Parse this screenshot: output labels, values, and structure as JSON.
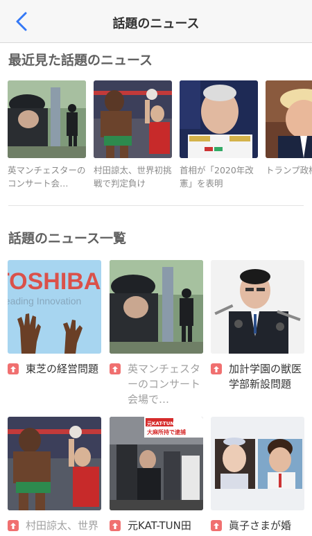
{
  "nav": {
    "title": "話題のニュース",
    "back_icon": "chevron-left-icon",
    "accent": "#3478f6"
  },
  "recent": {
    "heading": "最近見た話題のニュース",
    "items": [
      {
        "caption": "英マンチェスターのコンサート会…"
      },
      {
        "caption": "村田諒太、世界初挑戦で判定負け"
      },
      {
        "caption": "首相が「2020年改憲」を表明"
      },
      {
        "caption": "トランプ政権"
      }
    ]
  },
  "list": {
    "heading": "話題のニュース一覧",
    "badge_color": "#f07070",
    "items": [
      {
        "caption": "東芝の経営問題",
        "visited": false
      },
      {
        "caption": "英マンチェスターのコンサート会場で…",
        "visited": true
      },
      {
        "caption": "加計学園の獣医学部新設問題",
        "visited": false
      },
      {
        "caption": "村田諒太、世界",
        "visited": true
      },
      {
        "caption": "元KAT-TUN田",
        "visited": false
      },
      {
        "caption": "眞子さまが婚",
        "visited": false
      }
    ],
    "thumb_text": {
      "toshiba_logo": "TOSHIBA",
      "toshiba_tagline": "Leading Innovation",
      "kat_headline": "元KAT-TUN田中聖容疑者",
      "kat_sub": "大麻所持で逮捕"
    }
  }
}
